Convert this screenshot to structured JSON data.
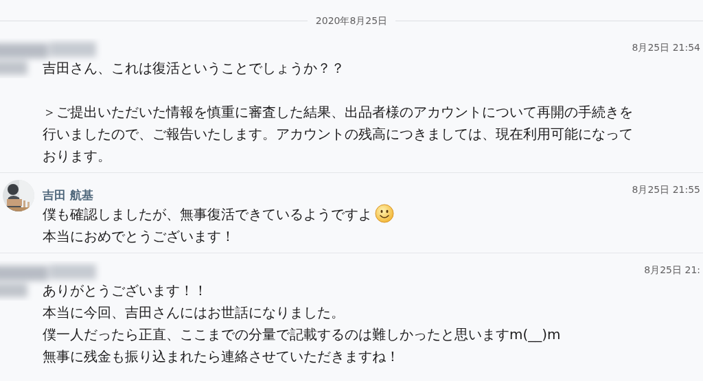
{
  "date_divider": "2020年8月25日",
  "messages": [
    {
      "sender": {
        "kind": "redacted"
      },
      "time": "8月25日 21:54",
      "paragraphs": [
        [
          [
            {
              "kind": "text",
              "text": "吉田さん、これは復活ということでしょうか？？"
            }
          ]
        ],
        [
          [
            {
              "kind": "text",
              "text": "＞ご提出いただいた情報を慎重に審査した結果、出品者様のアカウントについて再開の手続きを"
            }
          ],
          [
            {
              "kind": "text",
              "text": "行いましたので、ご報告いたします。アカウントの残高につきましては、現在利用可能になって"
            }
          ],
          [
            {
              "kind": "text",
              "text": "おります。"
            }
          ]
        ]
      ]
    },
    {
      "sender": {
        "kind": "named",
        "name": "吉田 航基"
      },
      "time": "8月25日 21:55",
      "paragraphs": [
        [
          [
            {
              "kind": "text",
              "text": "僕も確認しましたが、無事復活できているようですよ"
            },
            {
              "kind": "emoji"
            }
          ],
          [
            {
              "kind": "text",
              "text": "本当におめでとうございます！"
            }
          ]
        ]
      ]
    },
    {
      "sender": {
        "kind": "redacted"
      },
      "time": "8月25日 21:",
      "paragraphs": [
        [
          [
            {
              "kind": "text",
              "text": "ありがとうございます！！"
            }
          ],
          [
            {
              "kind": "text",
              "text": "本当に今回、吉田さんにはお世話になりました。"
            }
          ],
          [
            {
              "kind": "text",
              "text": "僕一人だったら正直、ここまでの分量で記載するのは難しかったと思いますm(__)m"
            }
          ],
          [
            {
              "kind": "text",
              "text": "無事に残金も振り込まれたら連絡させていただきますね！"
            }
          ]
        ]
      ]
    }
  ]
}
